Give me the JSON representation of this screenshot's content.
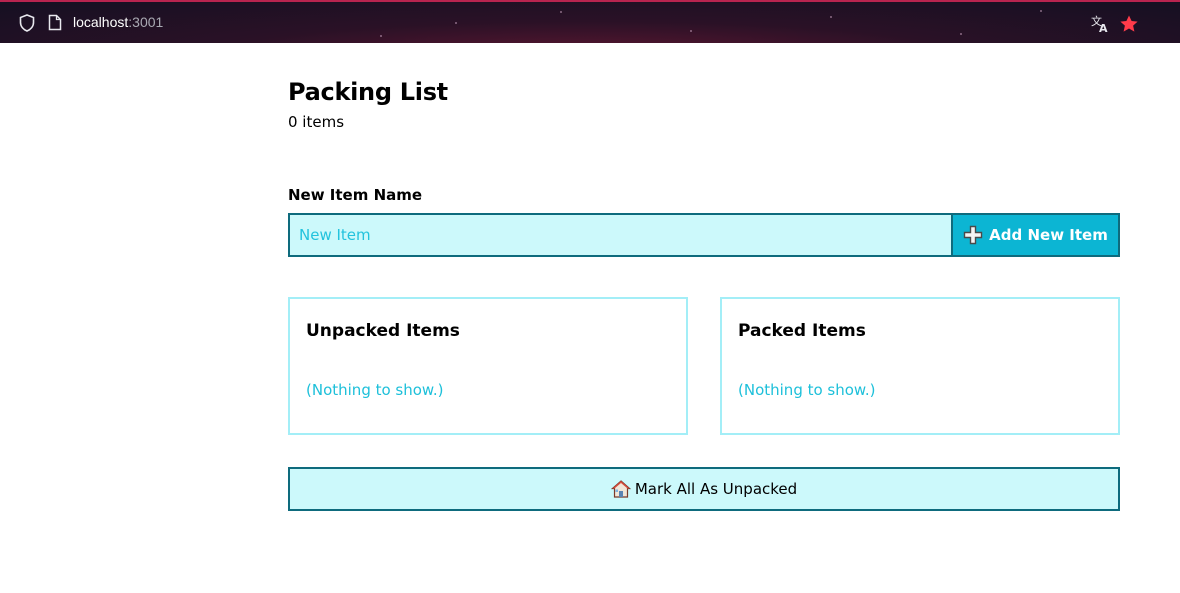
{
  "browser": {
    "url_host": "localhost",
    "url_port": ":3001",
    "icons": [
      "shield-icon",
      "page-icon",
      "translate-icon",
      "star-icon"
    ]
  },
  "header": {
    "title": "Packing List",
    "count": "0 items"
  },
  "new_item": {
    "label": "New Item Name",
    "placeholder": "New Item",
    "value": "",
    "add_button_label": "Add New Item",
    "add_button_icon": "plus-icon"
  },
  "panels": [
    {
      "title": "Unpacked Items",
      "empty_text": "(Nothing to show.)"
    },
    {
      "title": "Packed Items",
      "empty_text": "(Nothing to show.)"
    }
  ],
  "mark_all": {
    "label": "Mark All As Unpacked",
    "icon": "house-icon"
  },
  "colors": {
    "accent": "#0cb5d3",
    "input_bg": "#ccf9fb",
    "border_dark": "#0e6b7d",
    "panel_border": "#a3eef7",
    "empty_text": "#1ec0da",
    "star": "#ff3b4a"
  }
}
